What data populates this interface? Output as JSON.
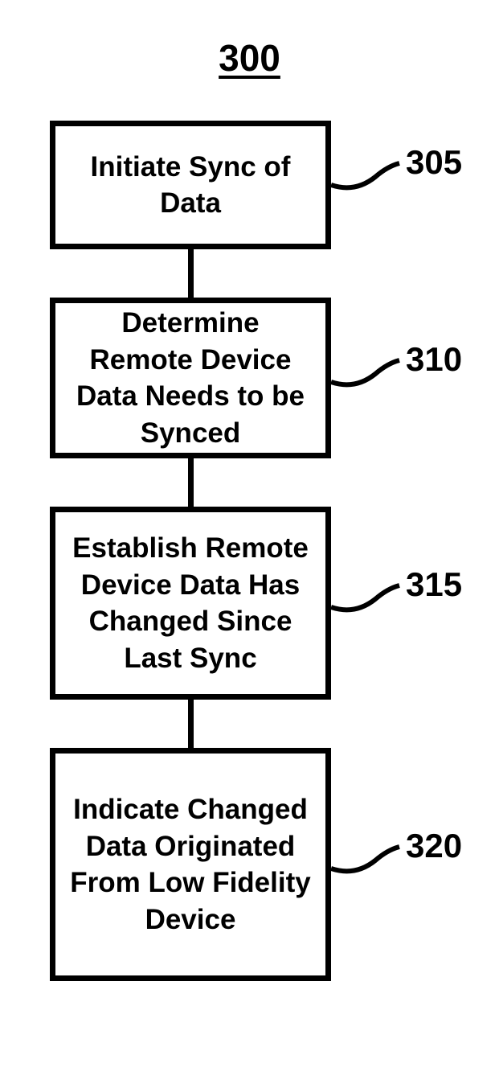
{
  "figure_number": "300",
  "boxes": [
    {
      "text": "Initiate Sync of Data",
      "label": "305"
    },
    {
      "text": "Determine Remote Device Data Needs to be Synced",
      "label": "310"
    },
    {
      "text": "Establish Remote Device Data Has Changed Since Last Sync",
      "label": "315"
    },
    {
      "text": "Indicate Changed Data Originated From Low Fidelity Device",
      "label": "320"
    }
  ]
}
